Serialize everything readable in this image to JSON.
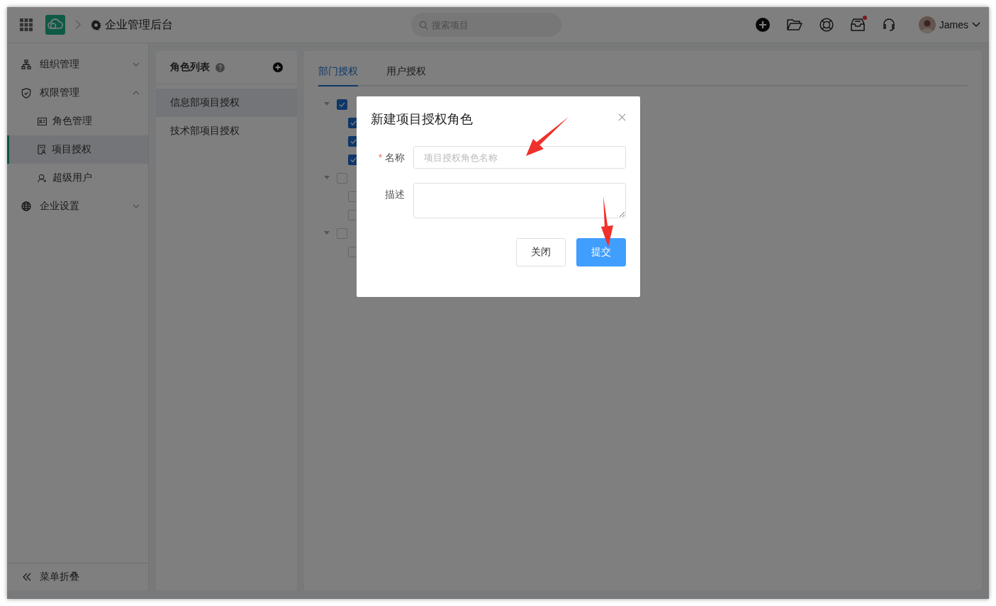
{
  "topbar": {
    "title": "企业管理后台",
    "search": {
      "placeholder": "搜索项目"
    },
    "inbox_unread": true,
    "user": {
      "name": "James"
    }
  },
  "sidebar": {
    "items": [
      {
        "label": "组织管理",
        "expanded": false
      },
      {
        "label": "权限管理",
        "expanded": true,
        "children": [
          {
            "label": "角色管理",
            "selected": false
          },
          {
            "label": "项目授权",
            "selected": true
          },
          {
            "label": "超级用户",
            "selected": false
          }
        ]
      },
      {
        "label": "企业设置",
        "expanded": false
      }
    ],
    "collapse_label": "菜单折叠"
  },
  "role_list": {
    "title": "角色列表",
    "items": [
      {
        "label": "信息部项目授权",
        "selected": true
      },
      {
        "label": "技术部项目授权",
        "selected": false
      }
    ]
  },
  "tabs": [
    {
      "label": "部门授权",
      "selected": true
    },
    {
      "label": "用户授权",
      "selected": false
    }
  ],
  "tree": [
    {
      "checked": true,
      "expanded": true,
      "children": [
        {
          "checked": true
        },
        {
          "checked": true
        },
        {
          "checked": true
        }
      ]
    },
    {
      "checked": false,
      "expanded": true,
      "children": [
        {
          "checked": false
        },
        {
          "checked": false
        }
      ]
    },
    {
      "checked": false,
      "expanded": true,
      "children": [
        {
          "checked": false
        }
      ]
    }
  ],
  "dialog": {
    "title": "新建项目授权角色",
    "fields": [
      {
        "kind": "input",
        "label": "名称",
        "required_mark": "*",
        "placeholder": "项目授权角色名称"
      },
      {
        "kind": "textarea",
        "label": "描述"
      }
    ],
    "buttons": [
      {
        "label": "关闭",
        "primary": false
      },
      {
        "label": "提交",
        "primary": true
      }
    ]
  }
}
